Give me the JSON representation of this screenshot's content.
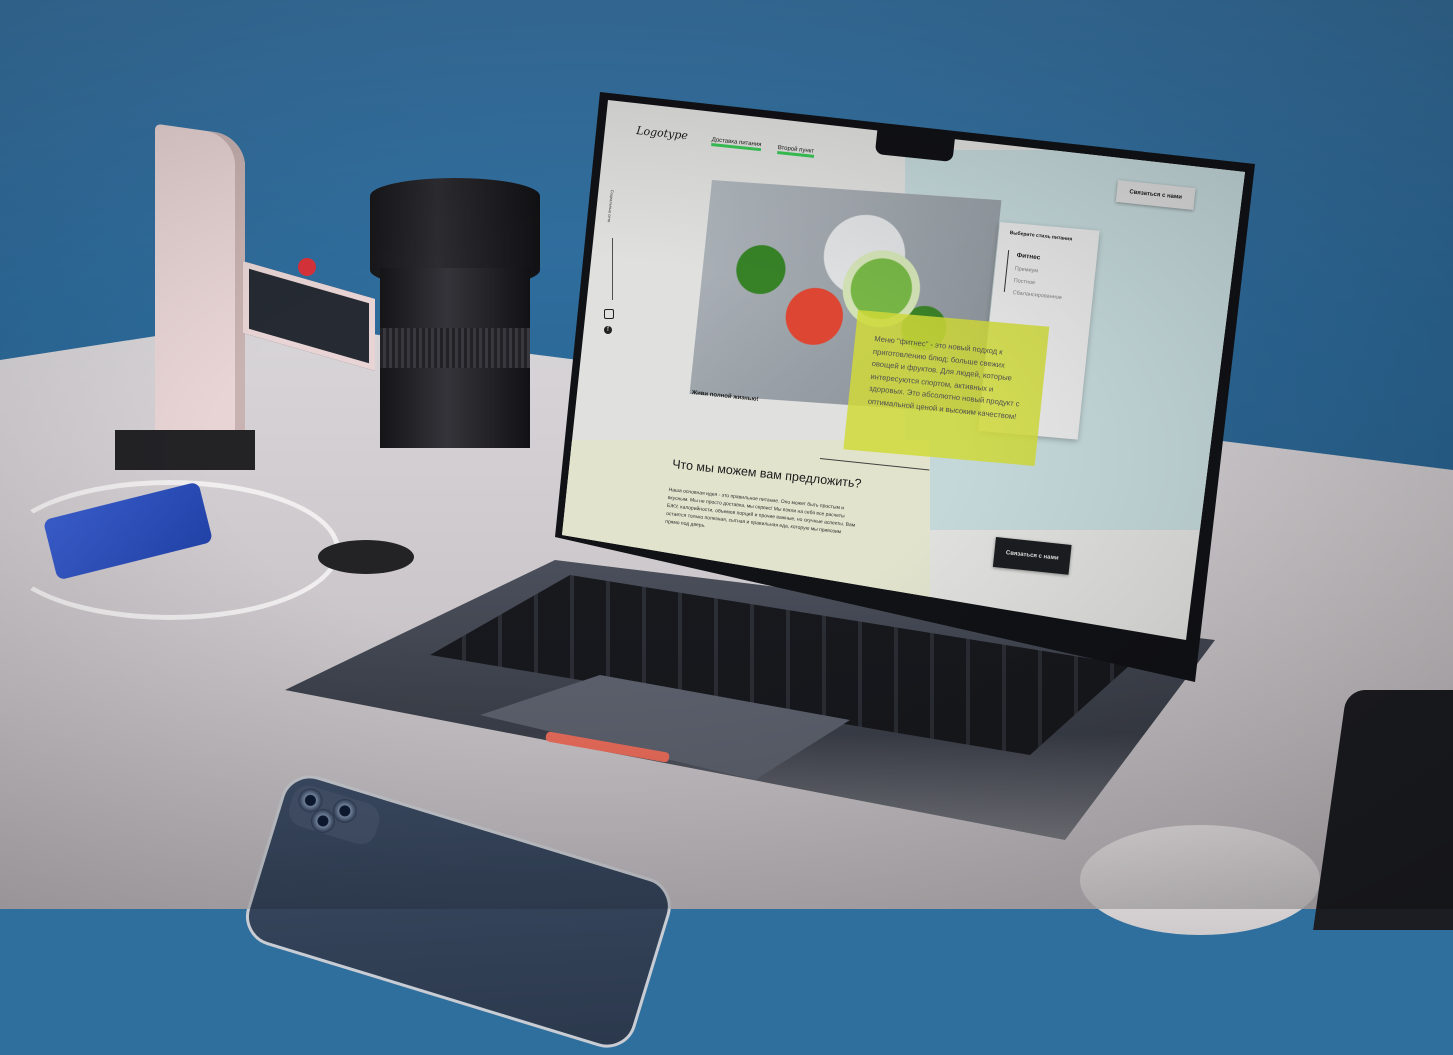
{
  "site": {
    "logo": "Logotype",
    "nav": [
      "Доставка питания",
      "Второй пункт"
    ],
    "contact_button": "Связаться с нами",
    "social_label": "Социальные сети",
    "tagline": "Живи полной жизнью!",
    "style_title": "Выберите стиль питания",
    "style_options": [
      "Фитнес",
      "Премиум",
      "Постное",
      "Сбалансированное"
    ],
    "description": "Меню \"фитнес\" - это новый подход к приготовлению блюд: больше свежих овощей и фруктов. Для людей, которые интересуются спортом, активных и здоровых. Это абсолютно новый продукт с оптимальной ценой и высоким качеством!",
    "offer_title": "Что мы можем вам предложить?",
    "offer_text": "Наша основная идея - это правильное питание. Оно может быть простым и вкусным. Мы не просто доставка, мы сервис! Мы взяли на себя все расчеты БЖУ, калорийности, объемов порций и прочие важные, но скучные аспекты. Вам остается только полезная, сытная и правильная еда, которую мы привозим прямо под дверь.",
    "contact_button_bottom": "Связаться с нами"
  },
  "colors": {
    "accent_green": "#3bd15a",
    "accent_yellow": "#dce63c",
    "teal_panel": "#cfe4e6",
    "dark_button": "#1d1f22"
  },
  "icons": [
    "instagram-icon",
    "facebook-icon"
  ]
}
